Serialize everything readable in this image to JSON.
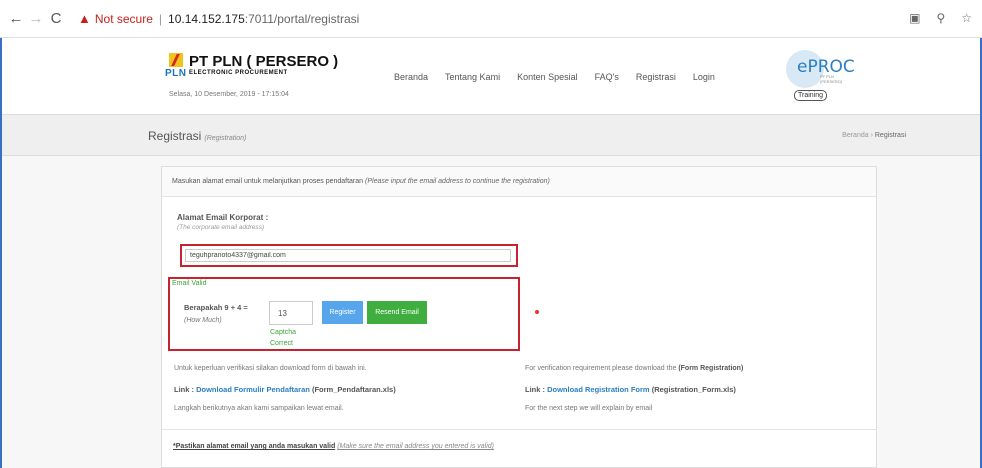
{
  "browser": {
    "back": "←",
    "forward": "→",
    "reload": "C",
    "security_label": "Not secure",
    "url_host": "10.14.152.175",
    "url_rest": ":7011/portal/registrasi"
  },
  "header": {
    "logo_text": "PLN",
    "brand_title": "PT PLN ( PERSERO )",
    "brand_subtitle": "ELECTRONIC PROCUREMENT",
    "datetime": "Selasa, 10 Desember, 2019 - 17:15:04",
    "nav": [
      "Beranda",
      "Tentang Kami",
      "Konten Spesial",
      "FAQ's",
      "Registrasi",
      "Login"
    ],
    "eproc_logo": "ePROC",
    "eproc_small": "PT PLN (PERSERO)",
    "eproc_badge": "Training"
  },
  "titlebar": {
    "title": "Registrasi",
    "title_en": "(Registration)",
    "breadcrumb_home": "Beranda",
    "breadcrumb_sep": "›",
    "breadcrumb_current": "Registrasi"
  },
  "form": {
    "intro": "Masukan alamat email untuk melanjutkan proses pendaftaran",
    "intro_en": "(Please input the email address to continue the registration)",
    "email_label": "Alamat Email Korporat :",
    "email_label_en": "(The corporate email address)",
    "email_value": "teguhpranoto4337@gmail.com",
    "email_status": "Email Valid",
    "captcha_question": "Berapakah 9 + 4 =",
    "captcha_question_en": "(How Much)",
    "captcha_value": "13",
    "captcha_status": "Captcha Correct",
    "register_label": "Register",
    "resend_label": "Resend Email"
  },
  "info": {
    "left_text": "Untuk keperluan verifikasi silakan download form di bawah ini.",
    "right_text": "For verification requirement please download the",
    "right_text_bold": "(Form Registration)",
    "left_link_prefix": "Link :",
    "left_link_text": "Download Formulir Pendaftaran",
    "left_link_suffix": "(Form_Pendaftaran.xls)",
    "right_link_prefix": "Link :",
    "right_link_text": "Download Registration Form",
    "right_link_suffix": "(Registration_Form.xls)",
    "left_next": "Langkah berikutnya akan kami sampaikan lewat email.",
    "right_next": "For the next step we will explain by email"
  },
  "footer": {
    "note": "*Pastikan alamat email yang anda masukan valid",
    "note_en": "(Make sure the email address you entered is valid)"
  },
  "colors": {
    "highlight_border": "#c4232f",
    "valid_green": "#3aa53a",
    "register_blue": "#57a6ec",
    "resend_green": "#3fae3f",
    "link_blue": "#2a7fc1"
  }
}
